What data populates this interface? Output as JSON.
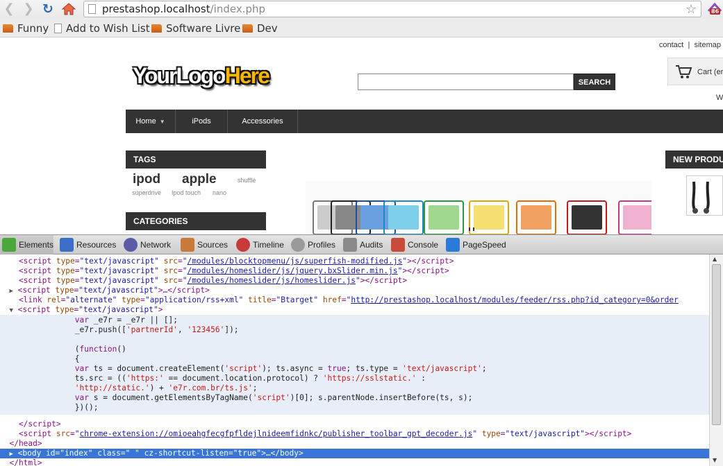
{
  "browser": {
    "url_host": "prestashop.localhost",
    "url_path": "/index.php",
    "extension_badge": "86"
  },
  "bookmarks": [
    "Funny",
    "Add to Wish List",
    "Software Livre",
    "Dev"
  ],
  "page": {
    "top_links": [
      "contact",
      "|",
      "sitemap"
    ],
    "logo_part1": "YourLogo",
    "logo_part2": "Here",
    "search_value": "",
    "search_button": "SEARCH",
    "cart_label": "Cart (er",
    "welcome_partial": "W",
    "menu": [
      "Home",
      "iPods",
      "Accessories"
    ],
    "tags_title": "TAGS",
    "tags_large": [
      "ipod",
      "apple"
    ],
    "tags_small": [
      "shuffle",
      "superdrive",
      "Ipod touch",
      "nano"
    ],
    "categories_title": "CATEGORIES",
    "new_products_title": "NEW PRODU"
  },
  "devtools": {
    "tabs": [
      "Elements",
      "Resources",
      "Network",
      "Sources",
      "Timeline",
      "Profiles",
      "Audits",
      "Console",
      "PageSpeed"
    ],
    "active_tab": "Elements"
  },
  "code": {
    "l1_src": "/modules/blocktopmenu/js/superfish-modified.js",
    "l2_src": "/modules/homeslider/js/jquery.bxSlider.min.js",
    "l3_src": "/modules/homeslider/js/homeslider.js",
    "link_title": "Btarget",
    "link_href": "http://prestashop.localhost/modules/feeder/rss.php?id_category=0&order",
    "partner_id": "'123456'",
    "ext_src": "chrome-extension://omioeahgfecgfpfldejlnideemfidnkc/publisher_toolbar_gpt_decoder.js",
    "body_id": "index",
    "body_class": " "
  }
}
